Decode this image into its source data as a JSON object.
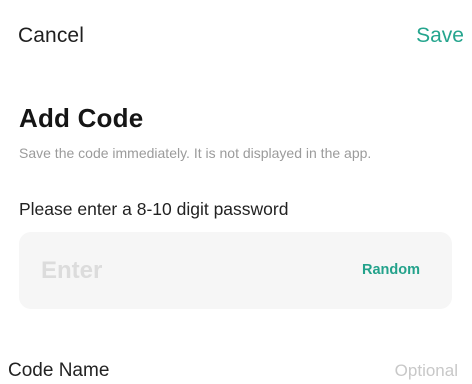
{
  "header": {
    "cancel_label": "Cancel",
    "save_label": "Save"
  },
  "page": {
    "title": "Add Code",
    "subtitle": "Save the code immediately. It is not displayed in the app."
  },
  "password": {
    "label": "Please enter a 8-10 digit password",
    "placeholder": "Enter",
    "value": "",
    "random_label": "Random"
  },
  "code_name": {
    "label": "Code Name",
    "placeholder": "Optional",
    "value": ""
  },
  "colors": {
    "accent": "#25a58e",
    "input_background": "#f6f6f6",
    "subtitle_text": "#9b9b9b",
    "placeholder_text": "#dcdcdc"
  }
}
